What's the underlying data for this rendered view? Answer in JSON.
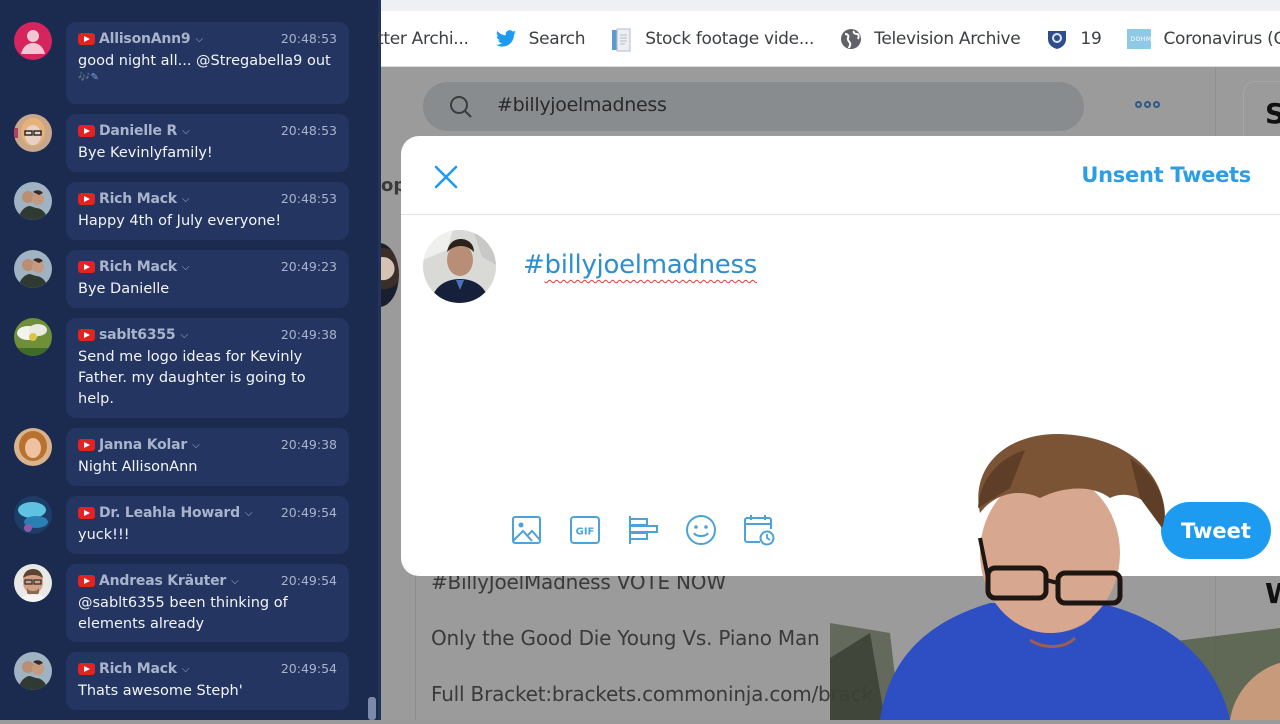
{
  "chat": {
    "messages": [
      {
        "author": "AllisonAnn9",
        "time": "20:48:53",
        "text": "good night all... @Stregabella9 out",
        "extra": "🎶✎",
        "avatar": "default-pink"
      },
      {
        "author": "Danielle R",
        "time": "20:48:53",
        "text": "Bye Kevinlyfamily!",
        "avatar": "photo-blonde-glasses"
      },
      {
        "author": "Rich Mack",
        "time": "20:48:53",
        "text": "Happy 4th of July everyone!",
        "avatar": "photo-couple"
      },
      {
        "author": "Rich Mack",
        "time": "20:49:23",
        "text": "Bye Danielle",
        "avatar": "photo-couple"
      },
      {
        "author": "sablt6355",
        "time": "20:49:38",
        "text": "Send me logo ideas for Kevinly Father. my daughter is going to help.",
        "avatar": "photo-flower"
      },
      {
        "author": "Janna Kolar",
        "time": "20:49:38",
        "text": "Night AllisonAnn",
        "avatar": "photo-redhead"
      },
      {
        "author": "Dr. Leahla Howard",
        "time": "20:49:54",
        "text": "yuck!!!",
        "avatar": "photo-blue-abstract"
      },
      {
        "author": "Andreas Kräuter",
        "time": "20:49:54",
        "text": "@sablt6355 been thinking of elements already",
        "avatar": "photo-man-glasses"
      },
      {
        "author": "Rich Mack",
        "time": "20:49:54",
        "text": "Thats awesome Steph'",
        "avatar": "photo-couple"
      }
    ],
    "source_icon": "youtube-icon",
    "colors": {
      "panel": "#1b2a4f",
      "bubble": "#233560",
      "author": "#a9b4cc",
      "text": "#f2f4f8"
    }
  },
  "browser": {
    "bookmarks": [
      {
        "label": "tter Archi...",
        "icon": "archive-icon"
      },
      {
        "label": "Search",
        "icon": "twitter-bird-icon"
      },
      {
        "label": "Stock footage vide...",
        "icon": "document-icon"
      },
      {
        "label": "Television Archive",
        "icon": "globe-icon"
      },
      {
        "label": "19",
        "icon": "shield-crest-icon"
      },
      {
        "label": "Coronavirus (COV",
        "icon": "dohmh-icon"
      }
    ]
  },
  "twitter": {
    "search": {
      "value": "#billyjoelmadness"
    },
    "tab_partial": "op",
    "side_card_letter": "S",
    "side_card_letter2": "W",
    "background_tweet": {
      "lines": [
        "#BillyJoelMadness  VOTE NOW",
        "Only the Good Die Young Vs. Piano Man",
        "Full Bracket:brackets.commoninja.com/brack"
      ]
    },
    "compose": {
      "unsent_label": "Unsent Tweets",
      "text": "#billyjoelmadness",
      "hash": "#",
      "word": "billyjoelmadness",
      "tweet_label": "Tweet",
      "toolbar": [
        "media-icon",
        "gif-icon",
        "poll-icon",
        "emoji-icon",
        "schedule-icon"
      ],
      "gif_label": "GIF"
    },
    "colors": {
      "accent": "#1d9bf0",
      "link": "#2d8ed0"
    }
  }
}
